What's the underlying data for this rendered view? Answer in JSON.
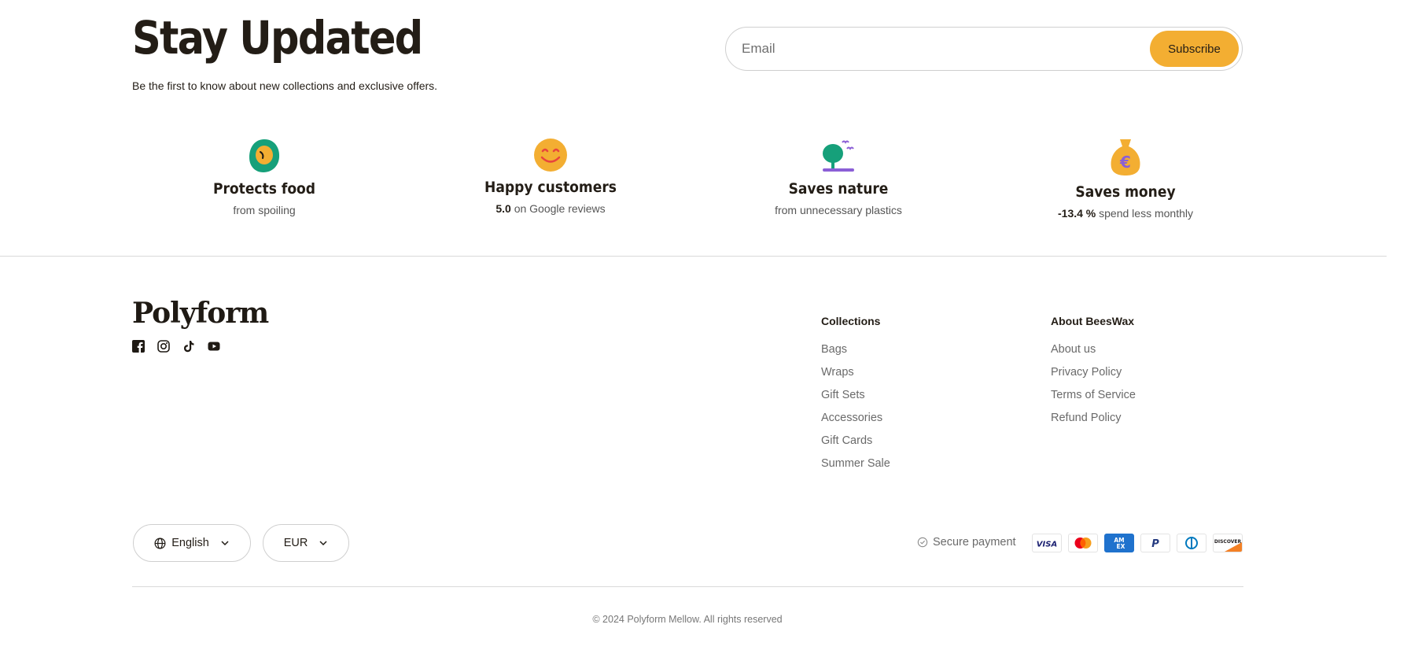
{
  "newsletter": {
    "title": "Stay Updated",
    "subtitle": "Be the first to know about new collections and exclusive offers.",
    "email_placeholder": "Email",
    "subscribe_label": "Subscribe",
    "accent_color": "#f3ae32"
  },
  "features": [
    {
      "icon": "egg-icon",
      "title": "Protects food",
      "subtitle": "from spoiling"
    },
    {
      "icon": "smiley-icon",
      "title": "Happy customers",
      "highlight": "5.0",
      "subtitle": "on Google reviews"
    },
    {
      "icon": "tree-icon",
      "title": "Saves nature",
      "subtitle": "from unnecessary plastics"
    },
    {
      "icon": "money-bag-icon",
      "title": "Saves money",
      "highlight": "-13.4 %",
      "subtitle": "spend less monthly"
    }
  ],
  "footer": {
    "brand": "Polyform",
    "socials": [
      "facebook-icon",
      "instagram-icon",
      "tiktok-icon",
      "youtube-icon"
    ],
    "columns": [
      {
        "title": "Collections",
        "links": [
          "Bags",
          "Wraps",
          "Gift Sets",
          "Accessories",
          "Gift Cards",
          "Summer Sale"
        ]
      },
      {
        "title": "About BeesWax",
        "links": [
          "About us",
          "Privacy Policy",
          "Terms of Service",
          "Refund Policy"
        ]
      }
    ],
    "language": "English",
    "currency": "EUR",
    "secure_label": "Secure payment",
    "payment_methods": [
      "visa",
      "mastercard",
      "amex",
      "paypal",
      "diners",
      "discover"
    ],
    "copyright": "© 2024 Polyform Mellow. All rights reserved"
  }
}
